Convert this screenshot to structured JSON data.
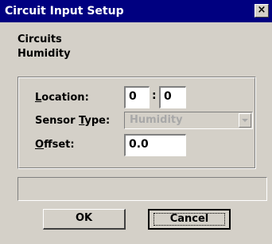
{
  "window": {
    "title": "Circuit Input Setup",
    "close_glyph": "×"
  },
  "header": {
    "line1": "Circuits",
    "line2": "Humidity"
  },
  "form": {
    "location_label_prefix": "L",
    "location_label_rest": "ocation:",
    "location_value_1": "0",
    "location_separator": ":",
    "location_value_2": "0",
    "sensor_type_label_prefix": "Sensor ",
    "sensor_type_label_underlined": "T",
    "sensor_type_label_rest": "ype:",
    "sensor_type_value": "Humidity",
    "offset_label_prefix": "O",
    "offset_label_rest": "ffset:",
    "offset_value": "0.0"
  },
  "status": {
    "text": ""
  },
  "buttons": {
    "ok_label": "OK",
    "cancel_label": "Cancel"
  },
  "icons": {
    "close": "close-icon",
    "dropdown": "chevron-down-icon"
  },
  "colors": {
    "titlebar": "#000080",
    "face": "#d4d0c8",
    "disabled_text": "#a8a8a8"
  }
}
